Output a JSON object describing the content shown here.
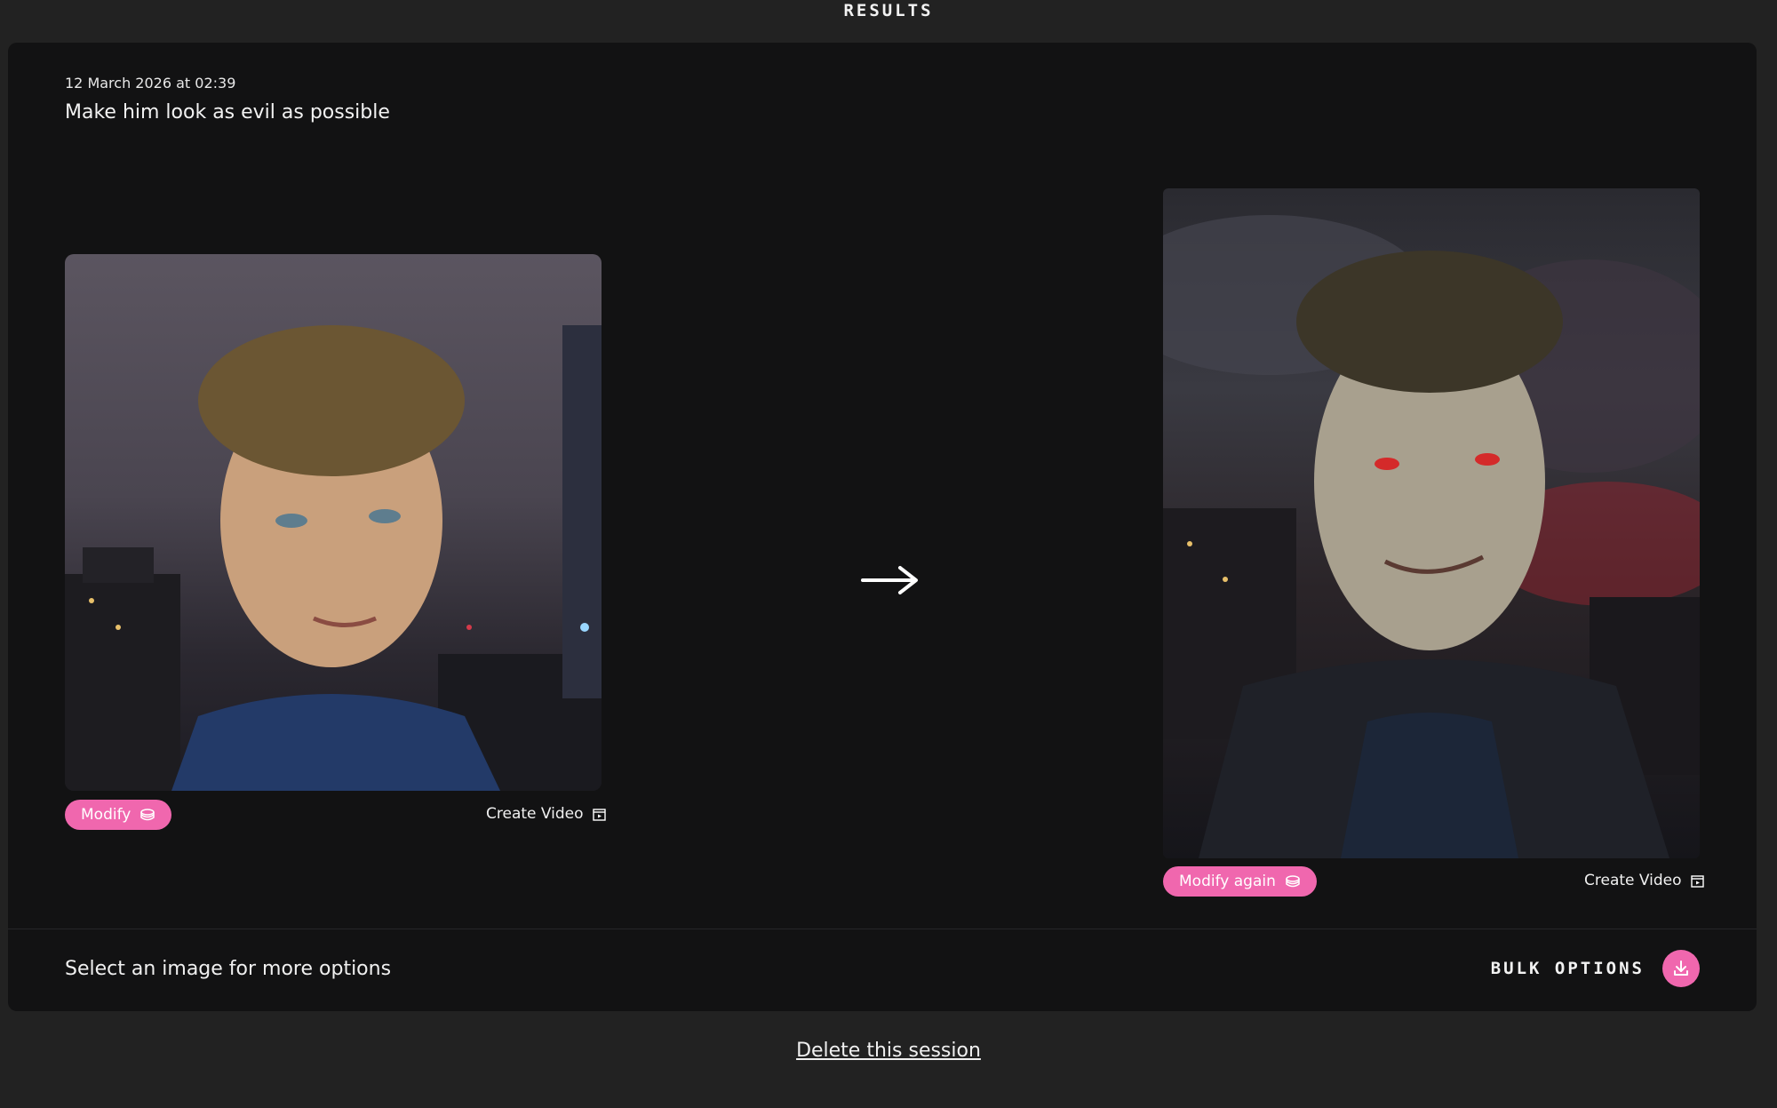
{
  "header": {
    "title": "RESULTS"
  },
  "session": {
    "timestamp": "12 March 2026 at 02:39",
    "prompt": "Make him look as evil as possible"
  },
  "original": {
    "modify_label": "Modify",
    "create_video_label": "Create Video"
  },
  "result": {
    "modify_label": "Modify again",
    "create_video_label": "Create Video"
  },
  "footer": {
    "hint": "Select an image for more options",
    "bulk_label": "BULK OPTIONS"
  },
  "delete_label": "Delete this session",
  "colors": {
    "accent": "#f067ae",
    "panel": "#121213",
    "background": "#222222"
  },
  "icons": {
    "arrow": "arrow-right-icon",
    "coin": "coins-icon",
    "video": "video-icon",
    "download": "download-icon"
  }
}
